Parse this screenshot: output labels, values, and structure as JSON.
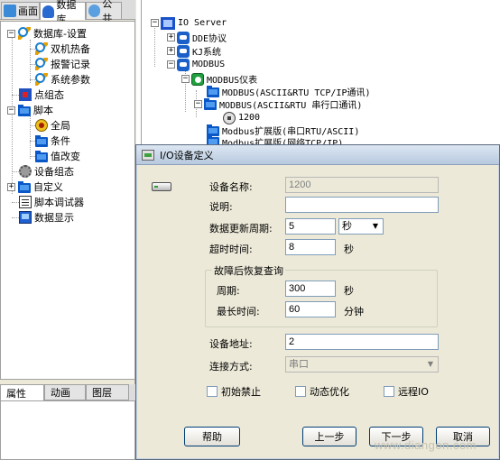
{
  "top_tabs": [
    {
      "label": "画面",
      "icon": "screen-icon"
    },
    {
      "label": "数据库",
      "icon": "database-icon"
    },
    {
      "label": "公共",
      "icon": "public-icon"
    }
  ],
  "tree": {
    "db_settings": "数据库-设置",
    "hot_standby": "双机热备",
    "alarm_record": "报警记录",
    "system_params": "系统参数",
    "point_config": "点组态",
    "script": "脚本",
    "global": "全局",
    "condition": "条件",
    "value_change": "值改变",
    "device_config": "设备组态",
    "custom": "自定义",
    "script_debugger": "脚本调试器",
    "data_display": "数据显示"
  },
  "bottom_tabs": [
    "属性",
    "动画",
    "图层"
  ],
  "device_tree": {
    "io_server": "IO Server",
    "dde": "DDE协议",
    "kj": "KJ系统",
    "modbus": "MODBUS",
    "modbus_meter": "MODBUS仪表",
    "modbus_tcp": "MODBUS(ASCII&RTU TCP/IP通讯)",
    "modbus_serial": "MODBUS(ASCII&RTU 串行口通讯)",
    "device_1200": "1200",
    "modbus_ext_serial": "Modbus扩展版(串口RTU/ASCII)",
    "modbus_ext_net": "Modbus扩展版(网络TCP/IP)"
  },
  "dialog": {
    "title": "I/O设备定义",
    "device_name_label": "设备名称:",
    "device_name_value": "1200",
    "description_label": "说明:",
    "description_value": "",
    "update_period_label": "数据更新周期:",
    "update_period_value": "5",
    "update_period_unit": "秒",
    "timeout_label": "超时时间:",
    "timeout_value": "8",
    "timeout_unit": "秒",
    "recovery_group_label": "故障后恢复查询",
    "period_label": "周期:",
    "period_value": "300",
    "period_unit": "秒",
    "max_time_label": "最长时间:",
    "max_time_value": "60",
    "max_time_unit": "分钟",
    "device_address_label": "设备地址:",
    "device_address_value": "2",
    "connection_label": "连接方式:",
    "connection_value": "串口",
    "init_disable": "初始禁止",
    "dynamic_optimize": "动态优化",
    "remote_io": "远程IO",
    "help_button": "帮助",
    "prev_button": "上一步",
    "next_button": "下一步",
    "cancel_button": "取消"
  },
  "watermark": "www.diangon.com"
}
